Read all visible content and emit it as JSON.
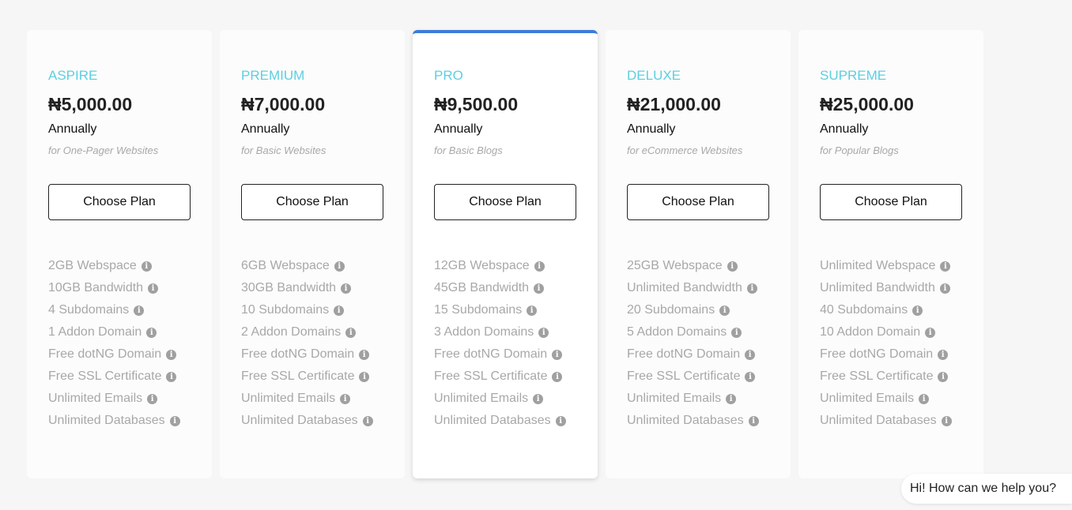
{
  "plans": [
    {
      "name": "ASPIRE",
      "price": "₦5,000.00",
      "cycle": "Annually",
      "description": "for One-Pager Websites",
      "button_label": "Choose Plan",
      "featured": false,
      "features": [
        "2GB Webspace",
        "10GB Bandwidth",
        "4 Subdomains",
        "1 Addon Domain",
        "Free dotNG Domain",
        "Free SSL Certificate",
        "Unlimited Emails",
        "Unlimited Databases"
      ]
    },
    {
      "name": "PREMIUM",
      "price": "₦7,000.00",
      "cycle": "Annually",
      "description": "for Basic Websites",
      "button_label": "Choose Plan",
      "featured": false,
      "features": [
        "6GB Webspace",
        "30GB Bandwidth",
        "10 Subdomains",
        "2 Addon Domains",
        "Free dotNG Domain",
        "Free SSL Certificate",
        "Unlimited Emails",
        "Unlimited Databases"
      ]
    },
    {
      "name": "PRO",
      "price": "₦9,500.00",
      "cycle": "Annually",
      "description": "for Basic Blogs",
      "button_label": "Choose Plan",
      "featured": true,
      "features": [
        "12GB Webspace",
        "45GB Bandwidth",
        "15 Subdomains",
        "3 Addon Domains",
        "Free dotNG Domain",
        "Free SSL Certificate",
        "Unlimited Emails",
        "Unlimited Databases"
      ]
    },
    {
      "name": "DELUXE",
      "price": "₦21,000.00",
      "cycle": "Annually",
      "description": "for eCommerce Websites",
      "button_label": "Choose Plan",
      "featured": false,
      "features": [
        "25GB Webspace",
        "Unlimited Bandwidth",
        "20 Subdomains",
        "5 Addon Domains",
        "Free dotNG Domain",
        "Free SSL Certificate",
        "Unlimited Emails",
        "Unlimited Databases"
      ]
    },
    {
      "name": "SUPREME",
      "price": "₦25,000.00",
      "cycle": "Annually",
      "description": "for Popular Blogs",
      "button_label": "Choose Plan",
      "featured": false,
      "features": [
        "Unlimited Webspace",
        "Unlimited Bandwidth",
        "40 Subdomains",
        "10 Addon Domain",
        "Free dotNG Domain",
        "Free SSL Certificate",
        "Unlimited Emails",
        "Unlimited Databases"
      ]
    }
  ],
  "chat": {
    "label": "Hi! How can we help you?"
  },
  "colors": {
    "plan_name": "#5ccfe0",
    "featured_accent": "#3b7dd8",
    "muted_text": "#a8a8a8"
  },
  "icons": {
    "feature_info": "info-icon"
  }
}
